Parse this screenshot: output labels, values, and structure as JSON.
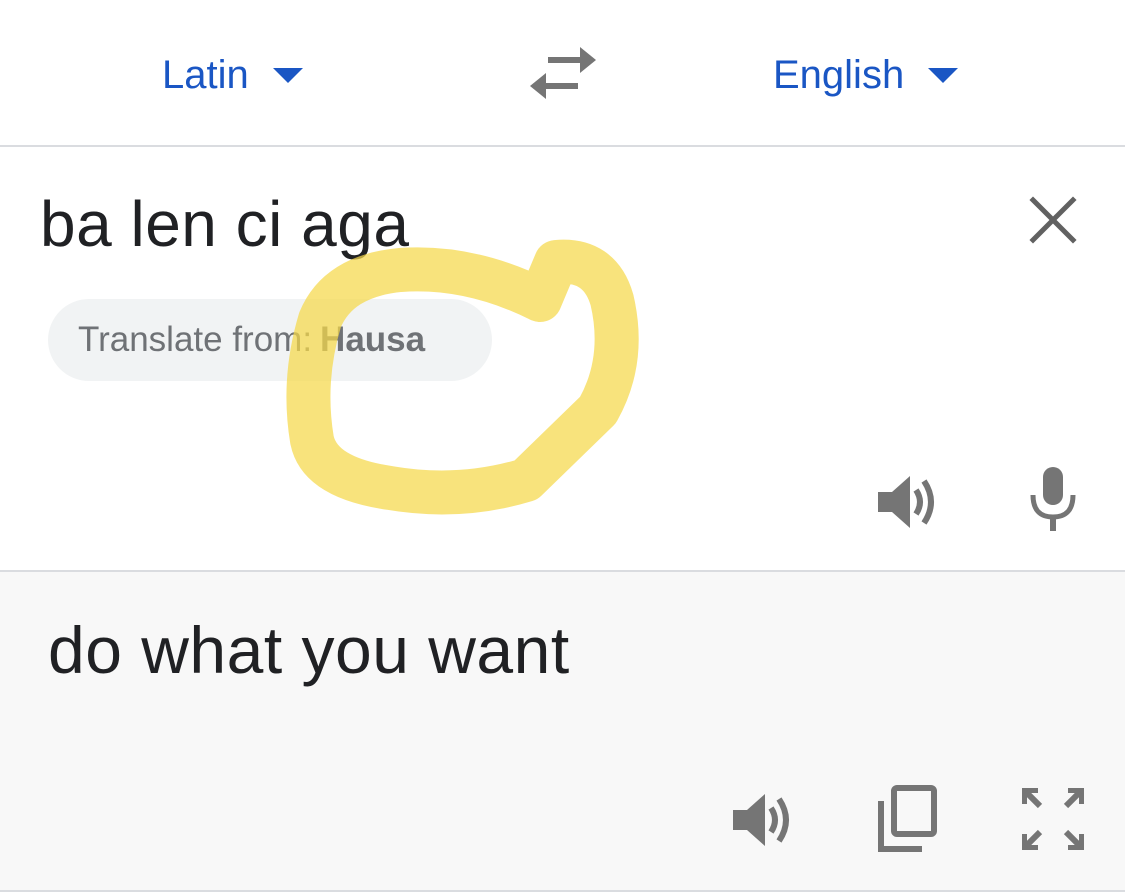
{
  "language_bar": {
    "source_language": "Latin",
    "target_language": "English",
    "icons": {
      "dropdown": "caret-down-icon",
      "swap": "swap-arrows-icon"
    }
  },
  "input": {
    "text": "ba len ci aga",
    "detect_chip": {
      "prefix": "Translate from:",
      "language": "Hausa"
    },
    "icons": {
      "clear": "close-icon",
      "listen": "speaker-icon",
      "voice": "microphone-icon"
    }
  },
  "output": {
    "text": "do what you want",
    "icons": {
      "listen": "speaker-icon",
      "copy": "copy-icon",
      "fullscreen": "fullscreen-icon"
    }
  },
  "annotation": {
    "type": "yellow-highlighter-loop",
    "color": "#f5d84a"
  },
  "colors": {
    "accent": "#1a56c4",
    "icon": "#757575",
    "chip_bg": "#f1f3f4",
    "output_bg": "#f8f8f8",
    "divider": "#dadce0"
  }
}
